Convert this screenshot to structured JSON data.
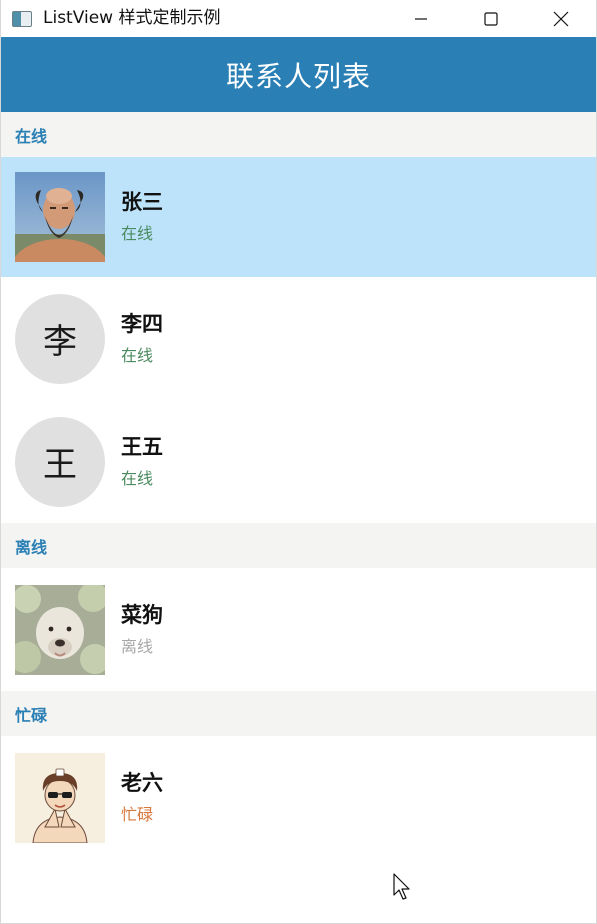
{
  "window": {
    "title": "ListView 样式定制示例",
    "app_icon": "app-window-icon",
    "controls": [
      "minimize-icon",
      "maximize-icon",
      "close-icon"
    ]
  },
  "header": {
    "title": "联系人列表",
    "color": "#2a7fb4"
  },
  "groups": [
    {
      "label": "在线",
      "contacts": [
        {
          "name": "张三",
          "status": "在线",
          "avatar": "photo-bald-bearded-man",
          "selected": true
        },
        {
          "name": "李四",
          "status": "在线",
          "avatar_text": "李"
        },
        {
          "name": "王五",
          "status": "在线",
          "avatar_text": "王"
        }
      ]
    },
    {
      "label": "离线",
      "contacts": [
        {
          "name": "菜狗",
          "status": "离线",
          "avatar": "photo-dog-with-cabbage"
        }
      ]
    },
    {
      "label": "忙碌",
      "contacts": [
        {
          "name": "老六",
          "status": "忙碌",
          "avatar": "cartoon-man-sunglasses"
        }
      ]
    }
  ],
  "colors": {
    "selected_row": "#bde3fb",
    "group_header_bg": "#f4f4f2",
    "online": "#4a8a5e",
    "offline": "#a8a8a8",
    "busy": "#d8773c"
  }
}
